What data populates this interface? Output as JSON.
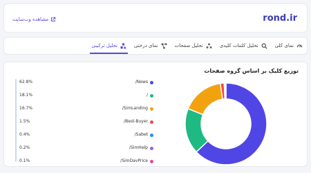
{
  "header": {
    "brand": "rond.ir",
    "site_link": "مشاهده وب‌سایت"
  },
  "tabs": [
    {
      "label": "نمای کلی",
      "icon": "gauge-icon",
      "active": false
    },
    {
      "label": "تحلیل کلمات کلیدی",
      "icon": "search-icon",
      "active": false
    },
    {
      "label": "تحلیل صفحات",
      "icon": "shapes-icon",
      "active": false
    },
    {
      "label": "نمای درختی",
      "icon": "tree-icon",
      "active": false
    },
    {
      "label": "تحلیل ترکیبی",
      "icon": "combined-icon",
      "active": true
    }
  ],
  "panel": {
    "title": "توزیع کلیک بر اساس گروه صفحات"
  },
  "colors": {
    "accent": "#5b46d6"
  },
  "chart_data": {
    "type": "pie",
    "style": "donut",
    "legend_position": "left",
    "categories": [
      "/News",
      "/",
      "/SimLanding",
      "/Best-Buyer",
      "/Sabet",
      "/SimHelp",
      "/SimDavPrice"
    ],
    "values": [
      62.8,
      18.1,
      16.7,
      1.5,
      0.4,
      0.2,
      0.1
    ],
    "labels": [
      "62.8%",
      "18.1%",
      "16.7%",
      "1.5%",
      "0.4%",
      "0.2%",
      "0.1%"
    ],
    "colors": [
      "#5046e5",
      "#1fba83",
      "#f3a20f",
      "#f04a4a",
      "#2f89f5",
      "#9c5de8",
      "#e8479a"
    ]
  }
}
